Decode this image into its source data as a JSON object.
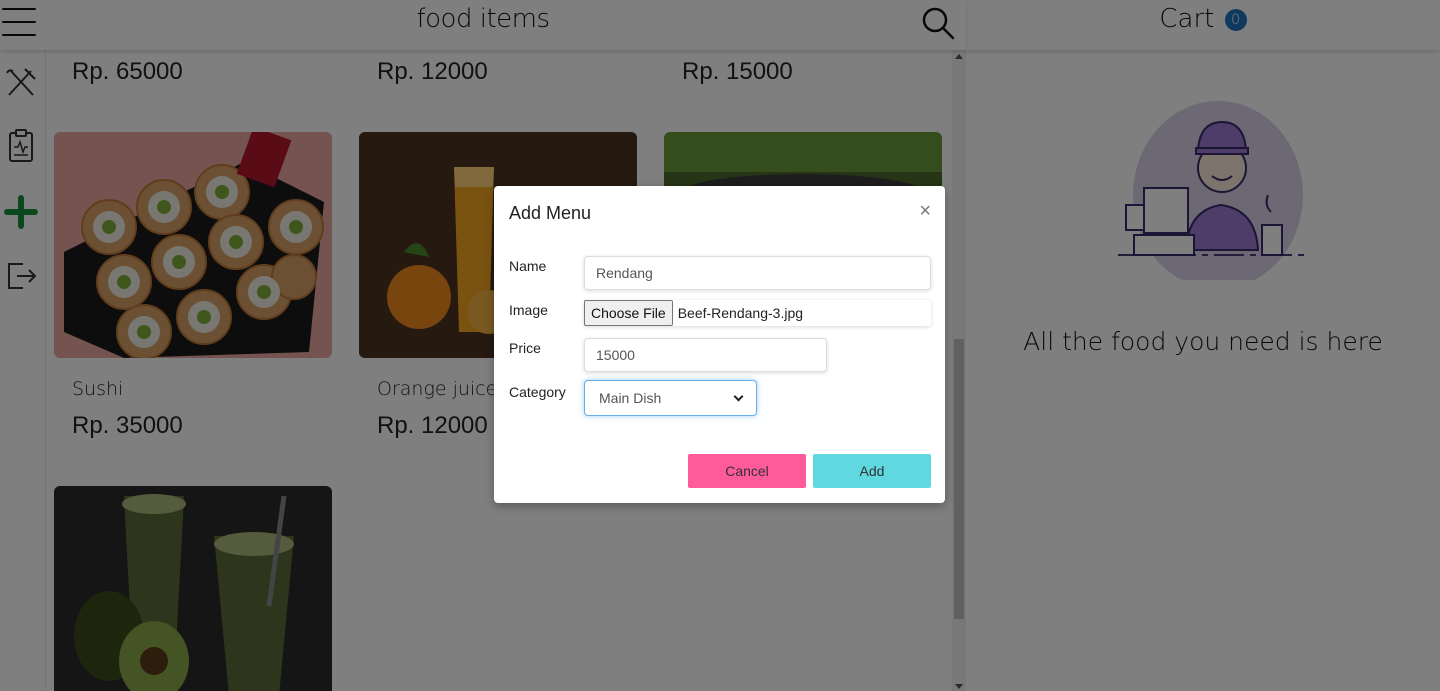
{
  "header": {
    "title": "food items",
    "menu_icon": "hamburger-menu-icon",
    "search_icon": "search-icon"
  },
  "sidebar": {
    "items": [
      {
        "icon": "utensils-icon"
      },
      {
        "icon": "clipboard-report-icon"
      },
      {
        "icon": "plus-icon",
        "color": "#1a8f3a"
      },
      {
        "icon": "logout-icon"
      }
    ]
  },
  "grid": {
    "top_prices": [
      "Rp. 65000",
      "Rp. 12000",
      "Rp. 15000"
    ],
    "cards": [
      {
        "name": "Sushi",
        "price": "Rp. 35000",
        "image": "sushi-image"
      },
      {
        "name": "Orange juice",
        "price": "Rp. 12000",
        "image": "orange-juice-image"
      },
      {
        "name": "",
        "price": "",
        "image": "salad-image"
      },
      {
        "name": "",
        "price": "",
        "image": "avocado-drink-image"
      }
    ]
  },
  "cart": {
    "title": "Cart",
    "count": "0",
    "message": "All the food you need is here",
    "illustration": "cashier-illustration"
  },
  "modal": {
    "title": "Add Menu",
    "close": "×",
    "fields": {
      "name_label": "Name",
      "name_value": "Rendang",
      "image_label": "Image",
      "file_button": "Choose File",
      "file_name": "Beef-Rendang-3.jpg",
      "price_label": "Price",
      "price_value": "15000",
      "category_label": "Category",
      "category_value": "Main Dish"
    },
    "cancel": "Cancel",
    "add": "Add"
  },
  "colors": {
    "cancel": "#ff5a9a",
    "add": "#5fd8e0",
    "badge": "#1e73be"
  }
}
